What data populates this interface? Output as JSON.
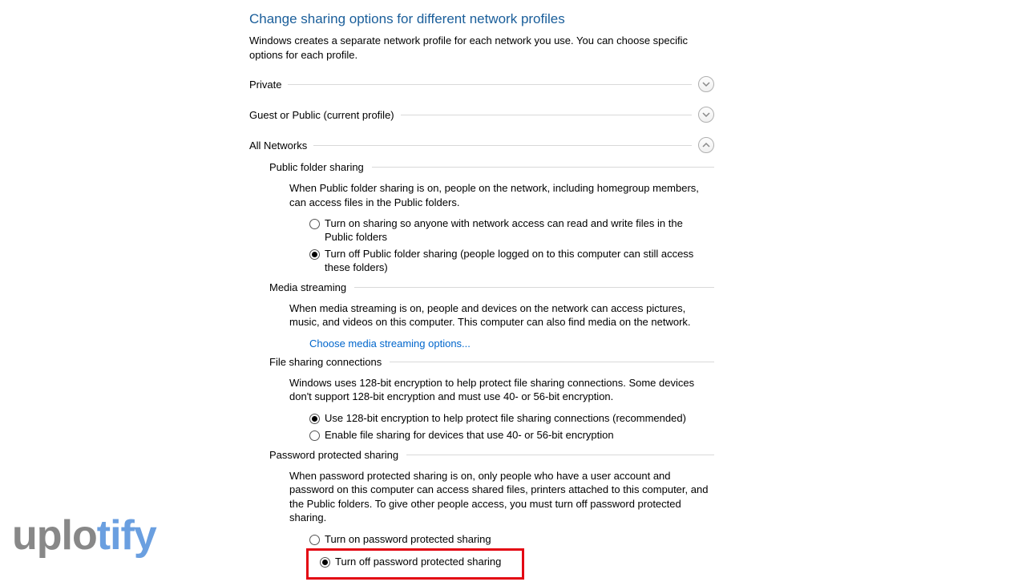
{
  "title": "Change sharing options for different network profiles",
  "description": "Windows creates a separate network profile for each network you use. You can choose specific options for each profile.",
  "profiles": {
    "private": {
      "label": "Private",
      "expanded": false
    },
    "guest": {
      "label": "Guest or Public (current profile)",
      "expanded": false
    },
    "all": {
      "label": "All Networks",
      "expanded": true
    }
  },
  "public_folder": {
    "heading": "Public folder sharing",
    "desc": "When Public folder sharing is on, people on the network, including homegroup members, can access files in the Public folders.",
    "opt_on": "Turn on sharing so anyone with network access can read and write files in the Public folders",
    "opt_off": "Turn off Public folder sharing (people logged on to this computer can still access these folders)",
    "selected": "off"
  },
  "media": {
    "heading": "Media streaming",
    "desc": "When media streaming is on, people and devices on the network can access pictures, music, and videos on this computer. This computer can also find media on the network.",
    "link": "Choose media streaming options..."
  },
  "encryption": {
    "heading": "File sharing connections",
    "desc": "Windows uses 128-bit encryption to help protect file sharing connections. Some devices don't support 128-bit encryption and must use 40- or 56-bit encryption.",
    "opt_128": "Use 128-bit encryption to help protect file sharing connections (recommended)",
    "opt_40": "Enable file sharing for devices that use 40- or 56-bit encryption",
    "selected": "128"
  },
  "password": {
    "heading": "Password protected sharing",
    "desc": "When password protected sharing is on, only people who have a user account and password on this computer can access shared files, printers attached to this computer, and the Public folders. To give other people access, you must turn off password protected sharing.",
    "opt_on": "Turn on password protected sharing",
    "opt_off": "Turn off password protected sharing",
    "selected": "off"
  },
  "watermark": {
    "part1": "uplo",
    "part2": "tify"
  }
}
